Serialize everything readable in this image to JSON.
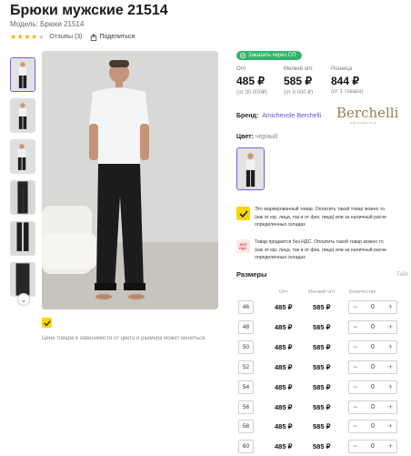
{
  "product": {
    "title": "Брюки мужские 21514",
    "model": "Модель: Брюки 21514",
    "rating": 4,
    "reviews": "Отзывы (3)",
    "share": "Поделиться"
  },
  "sp_badge": "Заказать через СП",
  "prices": [
    {
      "label": "Опт",
      "value": "485 ₽",
      "sub": "(от 35 000₽)"
    },
    {
      "label": "Мелкий опт",
      "value": "585 ₽",
      "sub": "(от 5 000 ₽)"
    },
    {
      "label": "Розница",
      "value": "844 ₽",
      "sub": "(от 1 товара)"
    }
  ],
  "brand": {
    "label": "Бренд:",
    "name": "Amichevole Berchelli",
    "logo_text": "Berchelli",
    "logo_sub": "AMICHEVOLE"
  },
  "color": {
    "label": "Цвет:",
    "value": "черный"
  },
  "notes": {
    "marked": "Это маркированный товар. Оплатить такой товар можно то\n(как от юр. лица, так и от физ. лица) или за наличный расче\nопределенных складах",
    "vat": "Товар продается без НДС. Оплатить такой товар можно то\n(как от юр. лица, так и от физ. лица) или за наличный расче\nопределенных складах",
    "vat_badge_line1": "БЕЗ",
    "vat_badge_line2": "НДС"
  },
  "price_note": "Цена товара в зависимости от цвета и размера может меняться",
  "sizes": {
    "title": "Размеры",
    "table_link": "Табл",
    "headers": {
      "opt": "Опт",
      "small_opt": "Мелкий опт",
      "qty": "Количество"
    },
    "rows": [
      {
        "size": "46",
        "opt": "485 ₽",
        "small_opt": "585 ₽",
        "qty": "0"
      },
      {
        "size": "48",
        "opt": "485 ₽",
        "small_opt": "585 ₽",
        "qty": "0"
      },
      {
        "size": "50",
        "opt": "485 ₽",
        "small_opt": "585 ₽",
        "qty": "0"
      },
      {
        "size": "52",
        "opt": "485 ₽",
        "small_opt": "585 ₽",
        "qty": "0"
      },
      {
        "size": "54",
        "opt": "485 ₽",
        "small_opt": "585 ₽",
        "qty": "0"
      },
      {
        "size": "56",
        "opt": "485 ₽",
        "small_opt": "585 ₽",
        "qty": "0"
      },
      {
        "size": "58",
        "opt": "485 ₽",
        "small_opt": "585 ₽",
        "qty": "0"
      },
      {
        "size": "60",
        "opt": "485 ₽",
        "small_opt": "585 ₽",
        "qty": "0"
      }
    ],
    "minus": "−",
    "plus": "+"
  },
  "colors": {
    "accent": "#7c5bd6",
    "sp_green": "#2fb56a",
    "marked_yellow": "#f6d800",
    "star": "#f5b301",
    "brand_link": "#6a4fcf"
  },
  "icons": {
    "share": "share-icon",
    "marked": "marked-icon",
    "vat": "no-vat-icon",
    "thumbs_next": "chevron-down-icon",
    "sp": "sp-icon"
  }
}
